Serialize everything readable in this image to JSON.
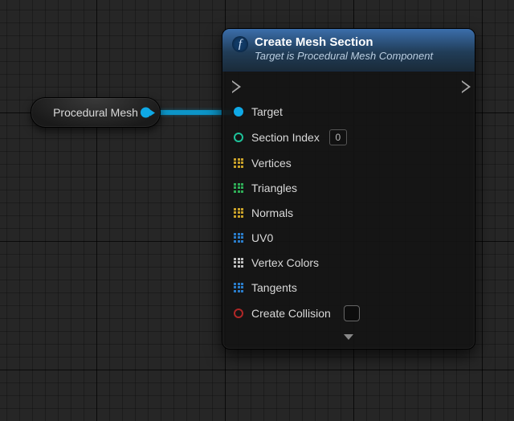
{
  "graph": {
    "variable_node": {
      "label": "Procedural Mesh",
      "output_pin": {
        "type": "object",
        "color": "#0fa9e6",
        "connected": true
      }
    },
    "function_node": {
      "icon_letter": "f",
      "title": "Create Mesh Section",
      "subtitle": "Target is Procedural Mesh Component",
      "exec_in": true,
      "exec_out": true,
      "pins": {
        "target": {
          "label": "Target",
          "kind": "object",
          "connected": true
        },
        "section_index": {
          "label": "Section Index",
          "kind": "int",
          "value": "0"
        },
        "vertices": {
          "label": "Vertices",
          "kind": "array",
          "color": "yellow"
        },
        "triangles": {
          "label": "Triangles",
          "kind": "array",
          "color": "green"
        },
        "normals": {
          "label": "Normals",
          "kind": "array",
          "color": "yellow"
        },
        "uv0": {
          "label": "UV0",
          "kind": "array",
          "color": "blue"
        },
        "vertex_colors": {
          "label": "Vertex Colors",
          "kind": "array",
          "color": "white"
        },
        "tangents": {
          "label": "Tangents",
          "kind": "array",
          "color": "blue"
        },
        "create_collision": {
          "label": "Create Collision",
          "kind": "bool",
          "checked": false
        }
      }
    }
  }
}
